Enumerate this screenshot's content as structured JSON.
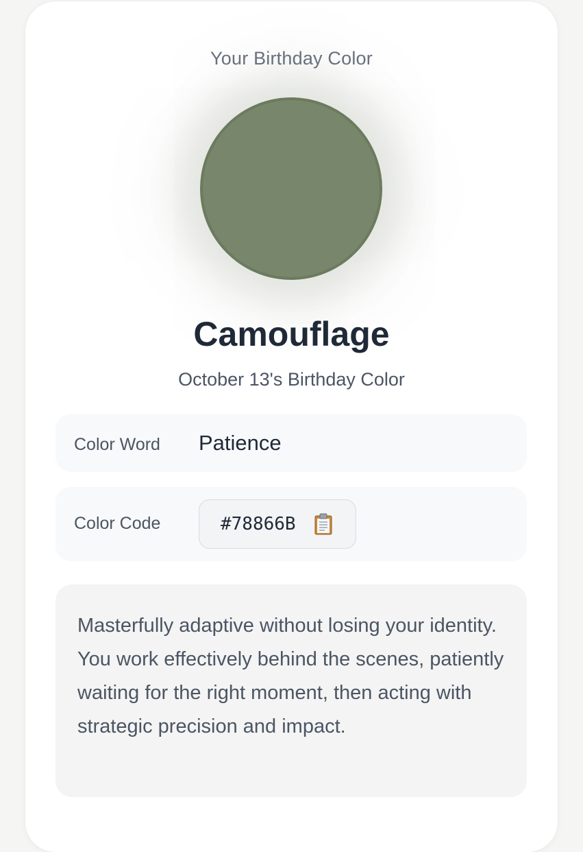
{
  "header": {
    "title": "Your Birthday Color"
  },
  "color": {
    "name": "Camouflage",
    "date_line": "October 13's Birthday Color",
    "hex": "#78866B",
    "border_hex": "#6C7A5E"
  },
  "details": {
    "word_label": "Color Word",
    "word_value": "Patience",
    "code_label": "Color Code",
    "code_value": "#78866B",
    "copy_icon": "clipboard-icon"
  },
  "description": "Masterfully adaptive without losing your identity. You work effectively behind the scenes, patiently waiting for the right moment, then acting with strategic precision and impact."
}
